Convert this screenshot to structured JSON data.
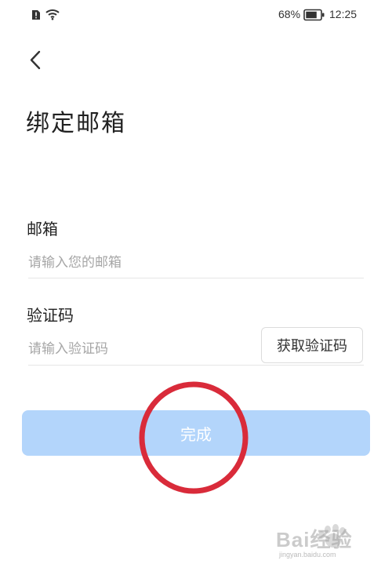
{
  "status_bar": {
    "battery_percent": "68%",
    "time": "12:25",
    "sim_icon": "sim-alert-icon",
    "wifi_icon": "wifi-icon",
    "battery_icon": "battery-icon"
  },
  "nav": {
    "back_icon": "chevron-left-icon"
  },
  "page": {
    "title": "绑定邮箱"
  },
  "form": {
    "email": {
      "label": "邮箱",
      "placeholder": "请输入您的邮箱",
      "value": ""
    },
    "code": {
      "label": "验证码",
      "placeholder": "请输入验证码",
      "value": "",
      "get_code_label": "获取验证码"
    }
  },
  "submit": {
    "label": "完成",
    "color": "#b3d5fb"
  },
  "annotation": {
    "color": "#d92b3a"
  },
  "watermark": {
    "text": "Bai经验",
    "sub": "jingyan.baidu.com"
  }
}
